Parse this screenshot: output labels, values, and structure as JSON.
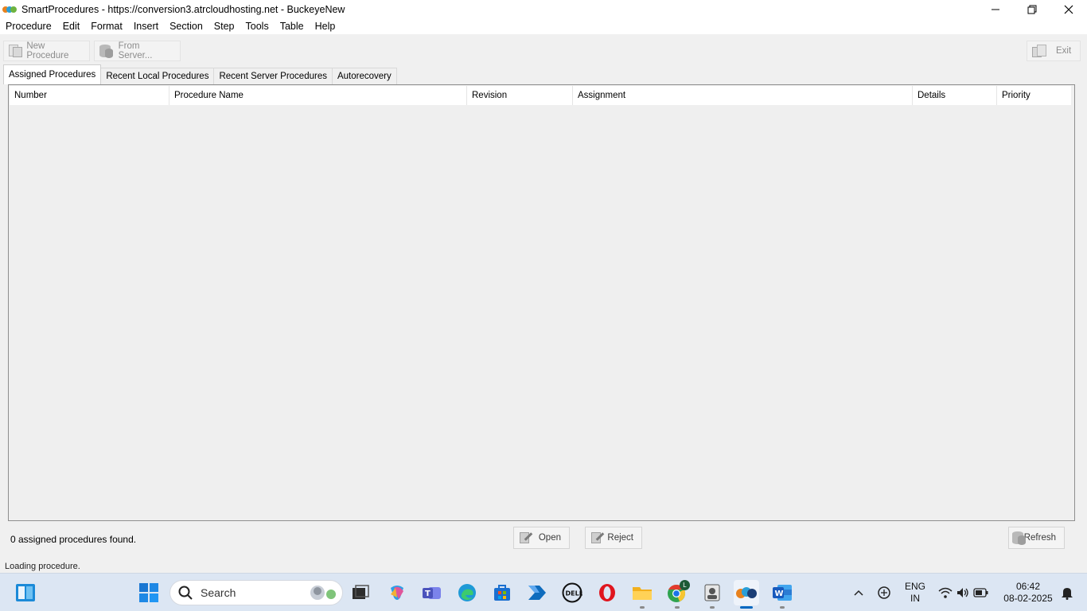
{
  "window": {
    "title": "SmartProcedures - https://conversion3.atrcloudhosting.net - BuckeyeNew"
  },
  "menu": [
    "Procedure",
    "Edit",
    "Format",
    "Insert",
    "Section",
    "Step",
    "Tools",
    "Table",
    "Help"
  ],
  "toolbar": {
    "new_procedure": "New Procedure",
    "from_server": "From Server...",
    "exit": "Exit"
  },
  "tabs": [
    "Assigned Procedures",
    "Recent Local Procedures",
    "Recent Server Procedures",
    "Autorecovery"
  ],
  "table": {
    "columns": [
      "Number",
      "Procedure Name",
      "Revision",
      "Assignment",
      "Details",
      "Priority"
    ]
  },
  "footer": {
    "count_text": "0 assigned procedures found.",
    "open": "Open",
    "reject": "Reject",
    "refresh": "Refresh",
    "status": "Loading procedure."
  },
  "taskbar": {
    "search_placeholder": "Search",
    "language": "ENG",
    "region": "IN",
    "time": "06:42",
    "date": "08-02-2025",
    "chrome_badge": "L"
  },
  "colors": {
    "accent": "#0067c0",
    "taskbar_bg": "#dce6f3"
  }
}
